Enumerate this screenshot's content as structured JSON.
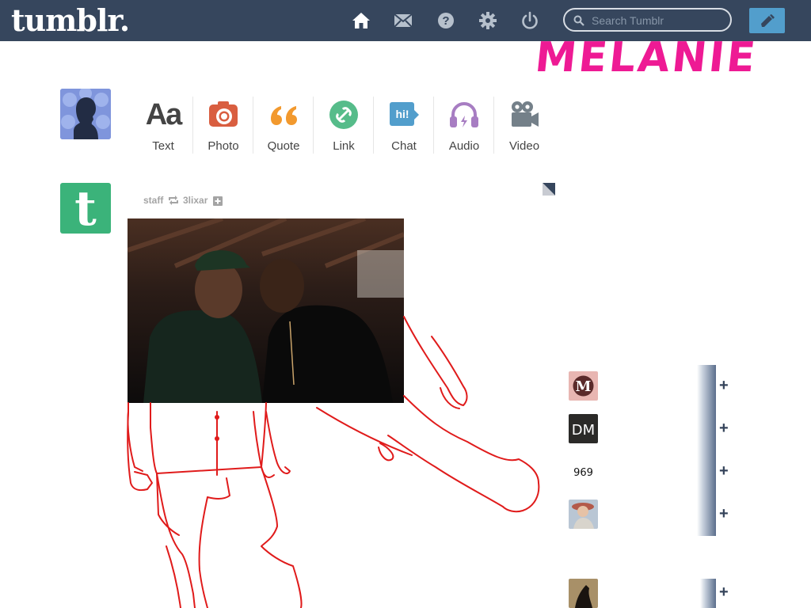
{
  "app": {
    "logo": "tumblr."
  },
  "nav": {
    "icons": [
      "home-icon",
      "mail-icon",
      "help-icon",
      "gear-icon",
      "power-icon"
    ]
  },
  "search": {
    "placeholder": "Search Tumblr"
  },
  "overlay": {
    "title": "MELANIE",
    "color": "#ee1a94",
    "doodle_color": "#e01b1b"
  },
  "post_types": [
    {
      "label": "Text",
      "icon": "text-icon",
      "color": "#444444"
    },
    {
      "label": "Photo",
      "icon": "camera-icon",
      "color": "#d95e40"
    },
    {
      "label": "Quote",
      "icon": "quote-icon",
      "color": "#f2992e"
    },
    {
      "label": "Link",
      "icon": "link-icon",
      "color": "#56bc8a"
    },
    {
      "label": "Chat",
      "icon": "chat-icon",
      "color": "#529ecc"
    },
    {
      "label": "Audio",
      "icon": "headphones-icon",
      "color": "#a77dc2"
    },
    {
      "label": "Video",
      "icon": "video-camera-icon",
      "color": "#748089"
    }
  ],
  "post": {
    "author": "staff",
    "reblogged_from": "3lixar",
    "avatar_letter": "t",
    "avatar_color": "#3bb37a"
  },
  "recommended": {
    "plus": "+",
    "items": [
      {
        "name": "m-logo-blog"
      },
      {
        "name": "dm-logo-blog"
      },
      {
        "name": "969-logo-blog"
      },
      {
        "name": "portrait-blog"
      },
      {
        "name": "dark-photo-blog"
      }
    ]
  },
  "colors": {
    "topbar": "#36465d",
    "compose": "#529ecc"
  }
}
